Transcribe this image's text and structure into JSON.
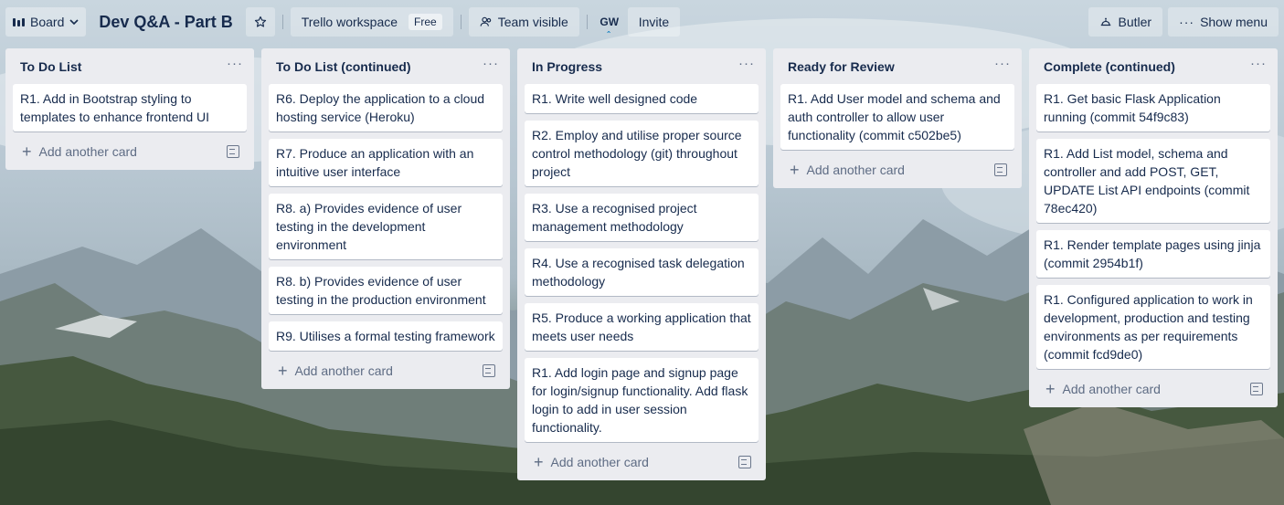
{
  "topbar": {
    "board_label": "Board",
    "title": "Dev Q&A - Part B",
    "workspace_label": "Trello workspace",
    "workspace_badge": "Free",
    "visibility_label": "Team visible",
    "member_initials": "GW",
    "invite_label": "Invite",
    "butler_label": "Butler",
    "show_menu_label": "Show menu"
  },
  "lists": [
    {
      "title": "To Do List",
      "cards": [
        "R1. Add in Bootstrap styling to templates to enhance frontend UI"
      ],
      "add_label": "Add another card"
    },
    {
      "title": "To Do List (continued)",
      "cards": [
        "R6. Deploy the application to a cloud hosting service (Heroku)",
        "R7. Produce an application with an intuitive user interface",
        "R8. a) Provides evidence of user testing in the development environment",
        "R8. b) Provides evidence of user testing in the production environment",
        "R9. Utilises a formal testing framework"
      ],
      "add_label": "Add another card"
    },
    {
      "title": "In Progress",
      "cards": [
        "R1. Write well designed code",
        "R2. Employ and utilise proper source control methodology (git) throughout project",
        "R3. Use a recognised project management methodology",
        "R4. Use a recognised task delegation methodology",
        "R5. Produce a working application that meets user needs",
        "R1. Add login page and signup page for login/signup functionality. Add flask login to add in user session functionality."
      ],
      "add_label": "Add another card"
    },
    {
      "title": "Ready for Review",
      "cards": [
        "R1. Add User model and schema and auth controller to allow user functionality (commit c502be5)"
      ],
      "add_label": "Add another card"
    },
    {
      "title": "Complete (continued)",
      "cards": [
        "R1. Get basic Flask Application running (commit 54f9c83)",
        "R1. Add List model, schema and controller and add POST, GET, UPDATE List API endpoints (commit 78ec420)",
        "R1. Render template pages using jinja (commit 2954b1f)",
        "R1. Configured application to work in development, production and testing environments as per requirements (commit fcd9de0)"
      ],
      "add_label": "Add another card"
    }
  ]
}
